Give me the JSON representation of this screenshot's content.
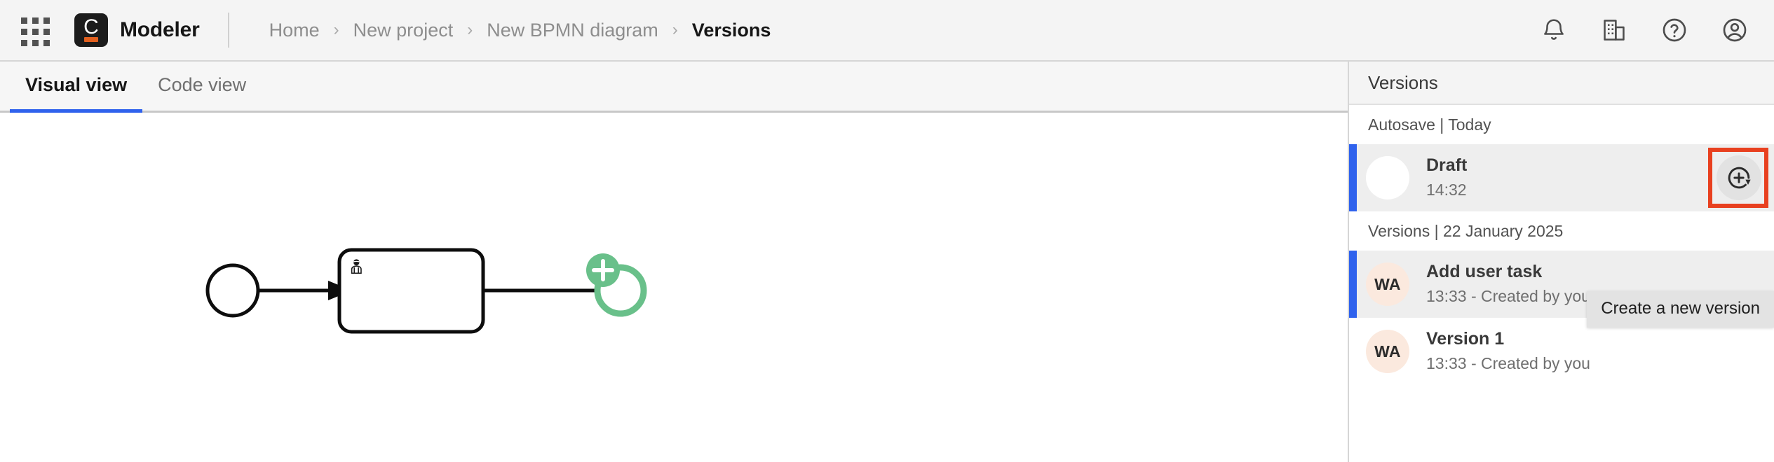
{
  "app": {
    "name": "Modeler",
    "logo_letter": "C",
    "app_switcher_icon": "grid-apps-icon"
  },
  "breadcrumb": {
    "separator": "›",
    "items": [
      {
        "label": "Home",
        "current": false
      },
      {
        "label": "New project",
        "current": false
      },
      {
        "label": "New BPMN diagram",
        "current": false
      },
      {
        "label": "Versions",
        "current": true
      }
    ]
  },
  "top_actions": [
    {
      "name": "notifications-bell-icon",
      "label": "Notifications"
    },
    {
      "name": "organization-building-icon",
      "label": "Organization"
    },
    {
      "name": "help-question-icon",
      "label": "Help"
    },
    {
      "name": "user-account-icon",
      "label": "Account"
    }
  ],
  "tabs": [
    {
      "label": "Visual view",
      "active": true
    },
    {
      "label": "Code view",
      "active": false
    }
  ],
  "diagram": {
    "type": "bpmn",
    "elements": [
      {
        "kind": "start-event",
        "label": ""
      },
      {
        "kind": "user-task",
        "label": ""
      },
      {
        "kind": "end-event",
        "label": ""
      }
    ],
    "append_badge": "+",
    "accent_color": "#69c08a"
  },
  "panel": {
    "title": "Versions",
    "groups": [
      {
        "label": "Autosave | Today",
        "items": [
          {
            "title": "Draft",
            "subtitle": "14:32",
            "avatar_initials": "",
            "avatar_style": "blank",
            "selected": true,
            "has_action": true,
            "action_icon": "create-new-version-icon",
            "highlighted": true
          }
        ]
      },
      {
        "label": "Versions | 22 January 2025",
        "items": [
          {
            "title": "Add user task",
            "subtitle": "13:33 - Created by you",
            "avatar_initials": "WA",
            "avatar_style": "initials",
            "selected": true,
            "has_action": false,
            "action_icon": "",
            "highlighted": false
          },
          {
            "title": "Version 1",
            "subtitle": "13:33 - Created by you",
            "avatar_initials": "WA",
            "avatar_style": "initials",
            "selected": false,
            "has_action": false,
            "action_icon": "",
            "highlighted": false
          }
        ]
      }
    ]
  },
  "tooltip": {
    "text": "Create a new version"
  },
  "colors": {
    "accent_blue": "#2f62ed",
    "highlight_red": "#e8401f",
    "brand_orange": "#e2601f",
    "bpmn_green": "#69c08a",
    "topbar_bg": "#f4f4f4",
    "row_selected_bg": "#eeeeee"
  }
}
